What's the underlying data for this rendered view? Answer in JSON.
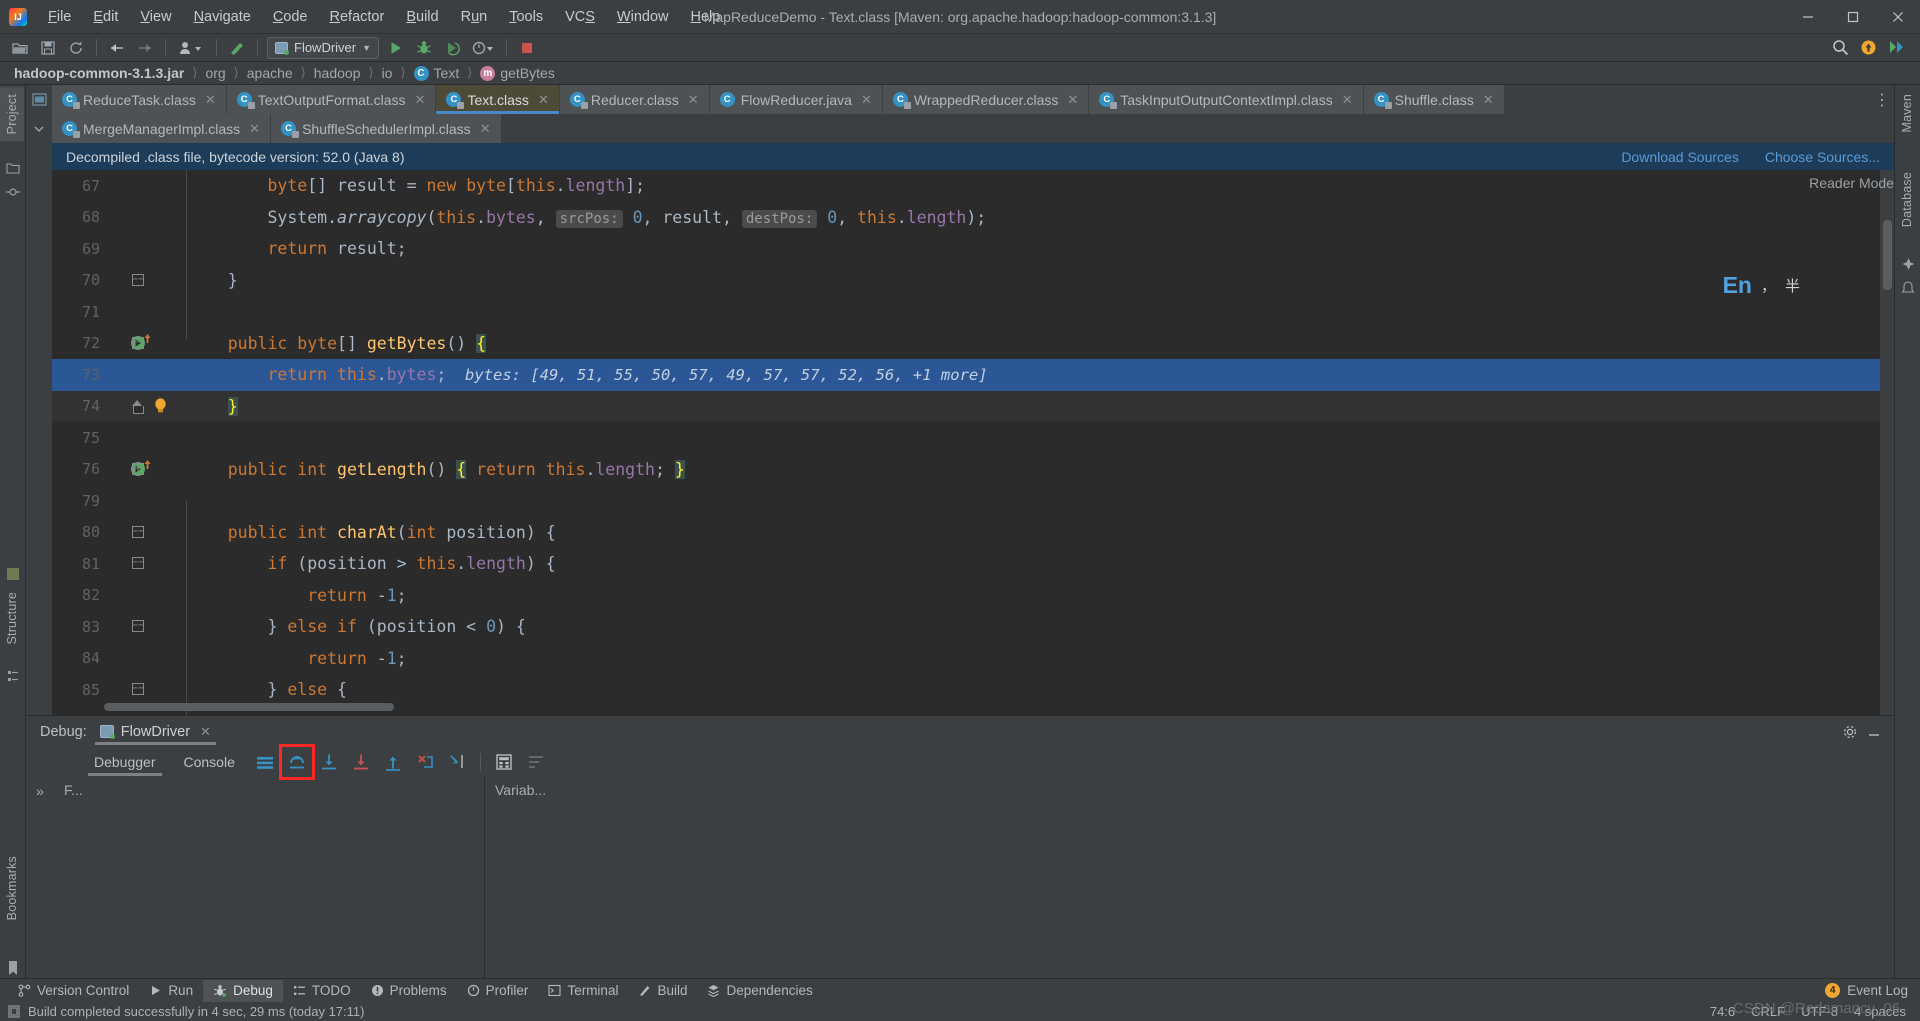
{
  "window": {
    "title": "MapReduceDemo - Text.class [Maven: org.apache.hadoop:hadoop-common:3.1.3]",
    "minimize": "–",
    "maximize": "❑",
    "close": "✕"
  },
  "menubar": [
    {
      "label": "File",
      "mnemonic": "F"
    },
    {
      "label": "Edit",
      "mnemonic": "E"
    },
    {
      "label": "View",
      "mnemonic": "V"
    },
    {
      "label": "Navigate",
      "mnemonic": "N"
    },
    {
      "label": "Code",
      "mnemonic": "C"
    },
    {
      "label": "Refactor",
      "mnemonic": "R"
    },
    {
      "label": "Build",
      "mnemonic": "B"
    },
    {
      "label": "Run",
      "mnemonic": "u"
    },
    {
      "label": "Tools",
      "mnemonic": "T"
    },
    {
      "label": "VCS",
      "mnemonic": "S"
    },
    {
      "label": "Window",
      "mnemonic": "W"
    },
    {
      "label": "Help",
      "mnemonic": "H"
    }
  ],
  "toolbar": {
    "run_config": "FlowDriver",
    "icons": [
      "open-folder-icon",
      "save-icon",
      "sync-icon",
      "back-arrow-icon",
      "forward-arrow-icon",
      "profile-dropdown-icon",
      "build-hammer-icon"
    ],
    "run_icon": "run-icon",
    "debug_icon": "debug-icon",
    "coverage_icon": "run-with-coverage-icon",
    "profile_icon": "profiler-icon",
    "stop_icon": "stop-icon",
    "search_icon": "search-everywhere-icon",
    "updates_icon": "updates-icon",
    "ide_icon": "ide-and-project-settings-icon"
  },
  "breadcrumb": [
    {
      "label": "hadoop-common-3.1.3.jar",
      "icon": null,
      "bold": true
    },
    {
      "label": "org",
      "icon": null,
      "bold": false
    },
    {
      "label": "apache",
      "icon": null,
      "bold": false
    },
    {
      "label": "hadoop",
      "icon": null,
      "bold": false
    },
    {
      "label": "io",
      "icon": null,
      "bold": false
    },
    {
      "label": "Text",
      "icon": "class-icon",
      "bold": false
    },
    {
      "label": "getBytes",
      "icon": "method-icon",
      "bold": false
    }
  ],
  "editor_tabs_row1": [
    {
      "label": "ReduceTask.class",
      "active": false,
      "highlighted": false
    },
    {
      "label": "TextOutputFormat.class",
      "active": false,
      "highlighted": false
    },
    {
      "label": "Text.class",
      "active": true,
      "highlighted": true
    },
    {
      "label": "Reducer.class",
      "active": false,
      "highlighted": false
    },
    {
      "label": "FlowReducer.java",
      "active": false,
      "highlighted": false
    },
    {
      "label": "WrappedReducer.class",
      "active": false,
      "highlighted": false
    },
    {
      "label": "TaskInputOutputContextImpl.class",
      "active": false,
      "highlighted": false
    },
    {
      "label": "Shuffle.class",
      "active": false,
      "highlighted": false
    }
  ],
  "editor_tabs_row2": [
    {
      "label": "MergeManagerImpl.class",
      "active": false,
      "highlighted": false
    },
    {
      "label": "ShuffleSchedulerImpl.class",
      "active": false,
      "highlighted": false
    }
  ],
  "notification": {
    "message": "Decompiled .class file, bytecode version: 52.0 (Java 8)",
    "download_sources": "Download Sources",
    "choose_sources": "Choose Sources..."
  },
  "editor": {
    "reader_mode": "Reader Mode",
    "ime": {
      "lang": "En",
      "punct": "，",
      "currency": "半"
    },
    "lines": [
      {
        "num": "67",
        "indent": 2,
        "tokens": [
          {
            "t": "byte",
            "c": "kw"
          },
          {
            "t": "[] ",
            "c": "plain"
          },
          {
            "t": "result ",
            "c": "plain"
          },
          {
            "t": "= ",
            "c": "plain"
          },
          {
            "t": "new ",
            "c": "kw"
          },
          {
            "t": "byte",
            "c": "kw"
          },
          {
            "t": "[",
            "c": "plain"
          },
          {
            "t": "this",
            "c": "kw"
          },
          {
            "t": ".",
            "c": "plain"
          },
          {
            "t": "length",
            "c": "fld"
          },
          {
            "t": "];",
            "c": "plain"
          }
        ]
      },
      {
        "num": "68",
        "indent": 2,
        "tokens": [
          {
            "t": "System",
            "c": "plain"
          },
          {
            "t": ".",
            "c": "plain"
          },
          {
            "t": "arraycopy",
            "c": "plain ital"
          },
          {
            "t": "(",
            "c": "plain"
          },
          {
            "t": "this",
            "c": "kw"
          },
          {
            "t": ".",
            "c": "plain"
          },
          {
            "t": "bytes",
            "c": "fld"
          },
          {
            "t": ", ",
            "c": "plain"
          },
          {
            "t": "srcPos:",
            "c": "hint"
          },
          {
            "t": " ",
            "c": "plain"
          },
          {
            "t": "0",
            "c": "num"
          },
          {
            "t": ", ",
            "c": "plain"
          },
          {
            "t": "result",
            "c": "plain"
          },
          {
            "t": ", ",
            "c": "plain"
          },
          {
            "t": "destPos:",
            "c": "hint"
          },
          {
            "t": " ",
            "c": "plain"
          },
          {
            "t": "0",
            "c": "num"
          },
          {
            "t": ", ",
            "c": "plain"
          },
          {
            "t": "this",
            "c": "kw"
          },
          {
            "t": ".",
            "c": "plain"
          },
          {
            "t": "length",
            "c": "fld"
          },
          {
            "t": ");",
            "c": "plain"
          }
        ]
      },
      {
        "num": "69",
        "indent": 2,
        "tokens": [
          {
            "t": "return ",
            "c": "kw"
          },
          {
            "t": "result;",
            "c": "plain"
          }
        ]
      },
      {
        "num": "70",
        "indent": 1,
        "fold": "down",
        "tokens": [
          {
            "t": "}",
            "c": "plain"
          }
        ]
      },
      {
        "num": "71",
        "indent": 0,
        "tokens": []
      },
      {
        "num": "72",
        "indent": 1,
        "fold": "down",
        "run_marker": true,
        "tokens": [
          {
            "t": "public ",
            "c": "kw"
          },
          {
            "t": "byte",
            "c": "kw"
          },
          {
            "t": "[] ",
            "c": "plain"
          },
          {
            "t": "getBytes",
            "c": "mth"
          },
          {
            "t": "() ",
            "c": "plain"
          },
          {
            "t": "{",
            "c": "brace"
          }
        ]
      },
      {
        "num": "73",
        "indent": 2,
        "selected": true,
        "tokens": [
          {
            "t": "return ",
            "c": "kw"
          },
          {
            "t": "this",
            "c": "kw"
          },
          {
            "t": ".",
            "c": "plain"
          },
          {
            "t": "bytes",
            "c": "fld"
          },
          {
            "t": ";",
            "c": "plain"
          }
        ],
        "debug_value": "bytes: [49, 51, 55, 50, 57, 49, 57, 57, 52, 56, +1 more]"
      },
      {
        "num": "74",
        "indent": 1,
        "fold": "up",
        "bulb": true,
        "cursor": true,
        "tokens": [
          {
            "t": "}",
            "c": "brace"
          }
        ]
      },
      {
        "num": "75",
        "indent": 0,
        "tokens": []
      },
      {
        "num": "76",
        "indent": 1,
        "fold": "plus",
        "run_marker": true,
        "tokens": [
          {
            "t": "public ",
            "c": "kw"
          },
          {
            "t": "int ",
            "c": "kw"
          },
          {
            "t": "getLength",
            "c": "mth"
          },
          {
            "t": "() ",
            "c": "plain"
          },
          {
            "t": "{",
            "c": "brace"
          },
          {
            "t": " ",
            "c": "plain"
          },
          {
            "t": "return ",
            "c": "kw"
          },
          {
            "t": "this",
            "c": "kw"
          },
          {
            "t": ".",
            "c": "plain"
          },
          {
            "t": "length",
            "c": "fld"
          },
          {
            "t": "; ",
            "c": "plain"
          },
          {
            "t": "}",
            "c": "brace"
          }
        ]
      },
      {
        "num": "79",
        "indent": 0,
        "tokens": []
      },
      {
        "num": "80",
        "indent": 1,
        "fold": "down",
        "tokens": [
          {
            "t": "public ",
            "c": "kw"
          },
          {
            "t": "int ",
            "c": "kw"
          },
          {
            "t": "charAt",
            "c": "mth"
          },
          {
            "t": "(",
            "c": "plain"
          },
          {
            "t": "int ",
            "c": "kw"
          },
          {
            "t": "position",
            "c": "plain"
          },
          {
            "t": ") {",
            "c": "plain"
          }
        ]
      },
      {
        "num": "81",
        "indent": 2,
        "fold": "down",
        "tokens": [
          {
            "t": "if ",
            "c": "kw"
          },
          {
            "t": "(position > ",
            "c": "plain"
          },
          {
            "t": "this",
            "c": "kw"
          },
          {
            "t": ".",
            "c": "plain"
          },
          {
            "t": "length",
            "c": "fld"
          },
          {
            "t": ") {",
            "c": "plain"
          }
        ]
      },
      {
        "num": "82",
        "indent": 3,
        "tokens": [
          {
            "t": "return ",
            "c": "kw"
          },
          {
            "t": "-",
            "c": "plain"
          },
          {
            "t": "1",
            "c": "num"
          },
          {
            "t": ";",
            "c": "plain"
          }
        ]
      },
      {
        "num": "83",
        "indent": 2,
        "fold": "down",
        "tokens": [
          {
            "t": "} ",
            "c": "plain"
          },
          {
            "t": "else if ",
            "c": "kw"
          },
          {
            "t": "(position < ",
            "c": "plain"
          },
          {
            "t": "0",
            "c": "num"
          },
          {
            "t": ") {",
            "c": "plain"
          }
        ]
      },
      {
        "num": "84",
        "indent": 3,
        "tokens": [
          {
            "t": "return ",
            "c": "kw"
          },
          {
            "t": "-",
            "c": "plain"
          },
          {
            "t": "1",
            "c": "num"
          },
          {
            "t": ";",
            "c": "plain"
          }
        ]
      },
      {
        "num": "85",
        "indent": 2,
        "fold": "down",
        "tokens": [
          {
            "t": "} ",
            "c": "plain"
          },
          {
            "t": "else ",
            "c": "kw"
          },
          {
            "t": "{",
            "c": "plain"
          }
        ]
      }
    ]
  },
  "debug_panel": {
    "label": "Debug:",
    "session": "FlowDriver",
    "subtabs": [
      {
        "label": "Debugger",
        "selected": true
      },
      {
        "label": "Console",
        "selected": false
      }
    ],
    "buttons": [
      {
        "name": "show-execution-point-icon",
        "boxed": false
      },
      {
        "name": "step-over-icon",
        "boxed": true
      },
      {
        "name": "step-into-icon",
        "boxed": false
      },
      {
        "name": "force-step-into-icon",
        "boxed": false
      },
      {
        "name": "step-out-icon",
        "boxed": false
      },
      {
        "name": "drop-frame-icon",
        "boxed": false
      },
      {
        "name": "run-to-cursor-icon",
        "boxed": false
      },
      {
        "name": "evaluate-expression-icon",
        "boxed": false
      },
      {
        "name": "settings-filter-icon",
        "boxed": false
      }
    ],
    "frames_header": "F...",
    "variables_header": "Variab...",
    "settings_icon": "gear-icon",
    "hide_icon": "hide-icon",
    "chevrons": "»"
  },
  "bottom_strip": {
    "items": [
      {
        "label": "Version Control",
        "icon": "branch-icon",
        "selected": false
      },
      {
        "label": "Run",
        "icon": "run-icon",
        "selected": false
      },
      {
        "label": "Debug",
        "icon": "debug-icon",
        "selected": true
      },
      {
        "label": "TODO",
        "icon": "todo-icon",
        "selected": false
      },
      {
        "label": "Problems",
        "icon": "problems-icon",
        "selected": false
      },
      {
        "label": "Profiler",
        "icon": "profiler-icon",
        "selected": false
      },
      {
        "label": "Terminal",
        "icon": "terminal-icon",
        "selected": false
      },
      {
        "label": "Build",
        "icon": "build-icon",
        "selected": false
      },
      {
        "label": "Dependencies",
        "icon": "dependencies-icon",
        "selected": false
      }
    ],
    "event_log": {
      "label": "Event Log",
      "count": "4"
    }
  },
  "status_bar": {
    "message": "Build completed successfully in 4 sec, 29 ms (today 17:11)",
    "caret": "74:6",
    "line_separator": "CRLF",
    "encoding": "UTF-8",
    "indent": "4 spaces"
  },
  "left_strip": {
    "project": "Project",
    "structure": "Structure",
    "bookmarks": "Bookmarks"
  },
  "right_strip": {
    "maven": "Maven",
    "database": "Database"
  },
  "watermark": "CSDN @Redamancy_06",
  "colors": {
    "accent": "#4a88c7",
    "notification_bg": "#1d3c5a",
    "selection_bg": "#2b5797",
    "highlight_box": "#ff2626",
    "editor_bg": "#2b2b2b",
    "chrome_bg": "#3c3f41"
  }
}
